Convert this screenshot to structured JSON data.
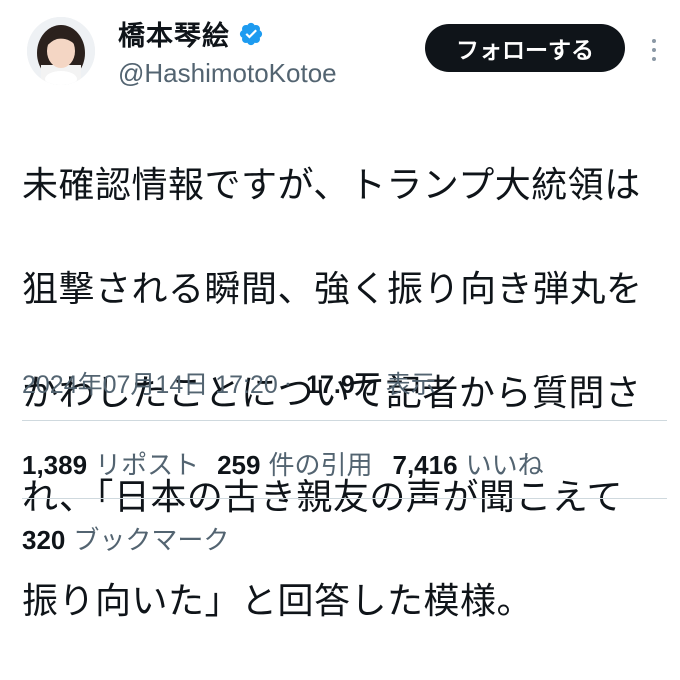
{
  "author": {
    "display_name": "橋本琴絵",
    "handle": "@HashimotoKotoe",
    "verified": true,
    "verified_color": "#1d9bf0"
  },
  "actions": {
    "follow_label": "フォローする",
    "more_icon": "more-vertical-icon"
  },
  "tweet": {
    "lines": [
      "未確認情報ですが、トランプ大統領は",
      "狙撃される瞬間、強く振り向き弾丸を",
      "かわしたことについて記者から質問さ",
      "れ、「日本の古き親友の声が聞こえて",
      "振り向いた」と回答した模様。"
    ]
  },
  "meta": {
    "timestamp": "2024年07月14日 17:20",
    "separator": "·",
    "views_count": "17.9万",
    "views_label": "表示"
  },
  "stats": {
    "reposts_count": "1,389",
    "reposts_label": "リポスト",
    "quotes_count": "259",
    "quotes_label": "件の引用",
    "likes_count": "7,416",
    "likes_label": "いいね",
    "bookmarks_count": "320",
    "bookmarks_label": "ブックマーク"
  }
}
